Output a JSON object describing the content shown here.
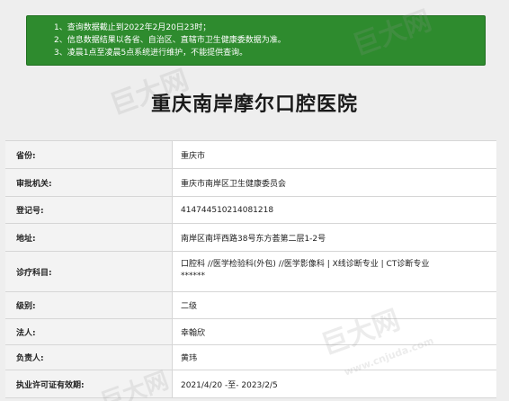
{
  "notice": {
    "lines": [
      "1、查询数据截止到2022年2月20日23时；",
      "2、信息数据结果以各省、自治区、直辖市卫生健康委数据为准。",
      "3、凌晨1点至凌晨5点系统进行维护，不能提供查询。"
    ],
    "background_color": "#2e8b2e"
  },
  "hospital": {
    "name": "重庆南岸摩尔口腔医院"
  },
  "info_rows": [
    {
      "label": "省份:",
      "value": "重庆市"
    },
    {
      "label": "审批机关:",
      "value": "重庆市南岸区卫生健康委员会"
    },
    {
      "label": "登记号:",
      "value": "414744510214081218"
    },
    {
      "label": "地址:",
      "value": "南岸区南坪西路38号东方荟第二层1-2号"
    },
    {
      "label": "诊疗科目:",
      "value_line1": "口腔科 //医学检验科(外包) //医学影像科 | X线诊断专业 | CT诊断专业",
      "value_line2": "******"
    },
    {
      "label": "级别:",
      "value": "二级"
    },
    {
      "label": "法人:",
      "value": "幸翰欣"
    },
    {
      "label": "负责人:",
      "value": "黄玮"
    },
    {
      "label": "执业许可证有效期:",
      "value": "2021/4/20 -至- 2023/2/5"
    }
  ],
  "watermark": {
    "brand": "巨大网",
    "url": "www.cnjuda.com"
  }
}
